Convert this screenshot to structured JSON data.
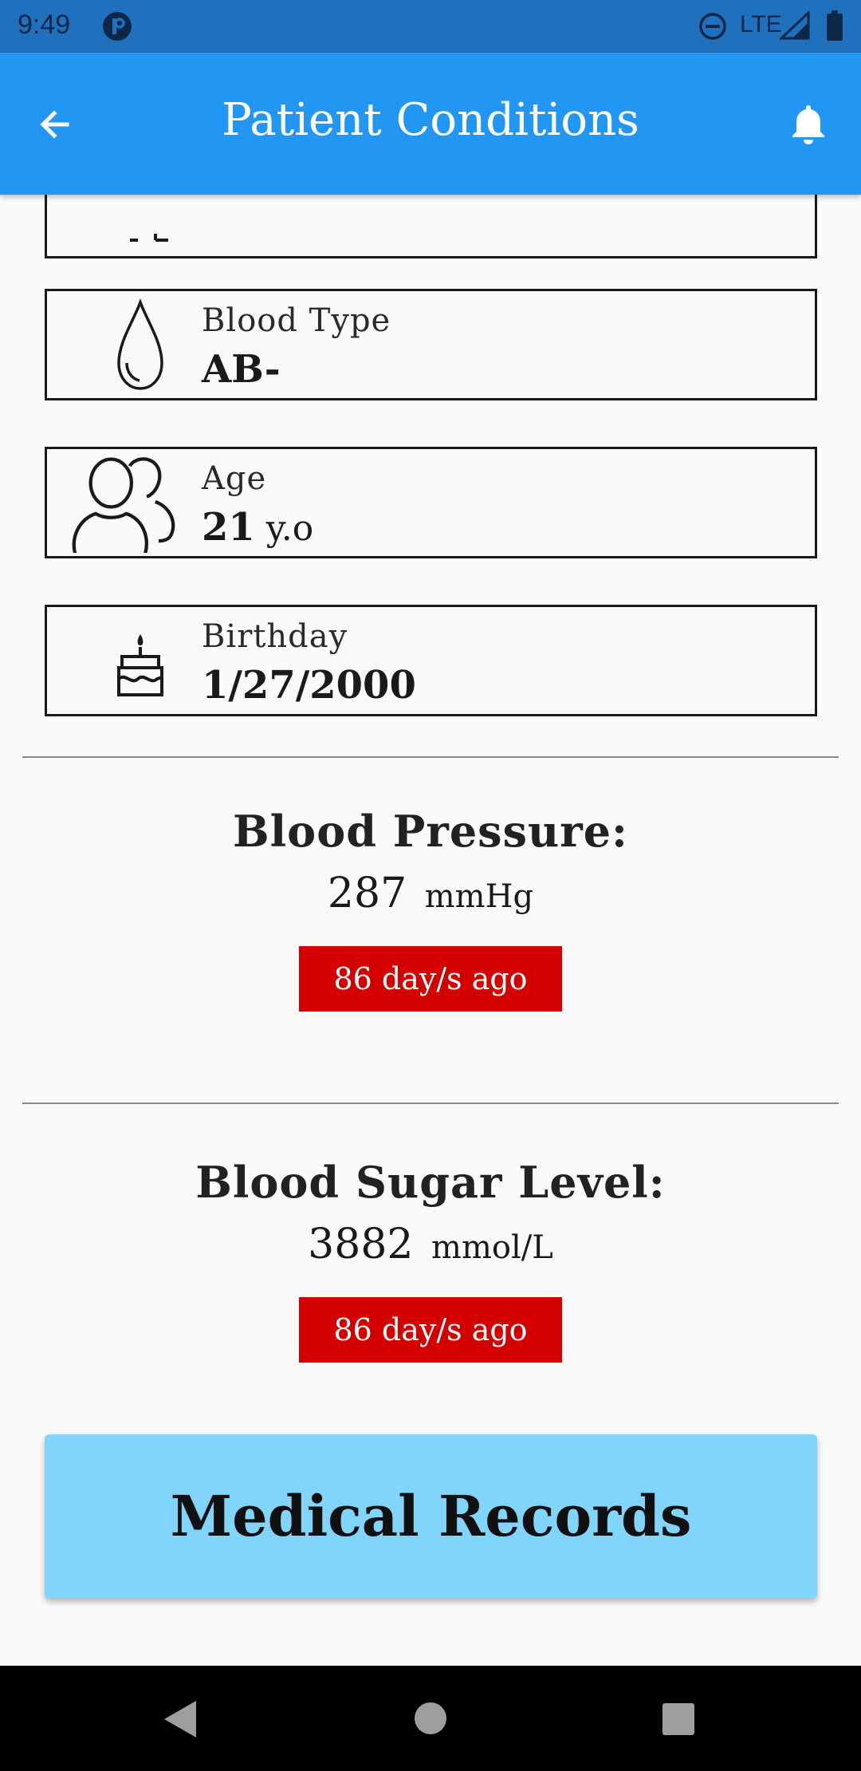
{
  "status_bar": {
    "time": "9:49",
    "network": "LTE"
  },
  "app_bar": {
    "title": "Patient Conditions",
    "back_icon": "arrow-left-icon",
    "notifications_icon": "bell-icon"
  },
  "info_cards": [
    {
      "label": "Blood Type",
      "value": "AB-",
      "unit": "",
      "icon": "drop-icon"
    },
    {
      "label": "Age",
      "value": "21",
      "unit": "y.o",
      "icon": "people-icon"
    },
    {
      "label": "Birthday",
      "value": "1/27/2000",
      "unit": "",
      "icon": "cake-icon"
    }
  ],
  "blood_pressure": {
    "title": "Blood Pressure:",
    "value": "287",
    "unit": "mmHg",
    "updated": "86 day/s ago"
  },
  "blood_sugar": {
    "title": "Blood Sugar Level:",
    "value": "3882",
    "unit": "mmol/L",
    "updated": "86 day/s ago"
  },
  "records_button": {
    "label": "Medical Records"
  },
  "colors": {
    "status_bar": "#1f70bd",
    "app_bar": "#2196f3",
    "badge": "#d40000",
    "records_button": "#81d4fa"
  }
}
